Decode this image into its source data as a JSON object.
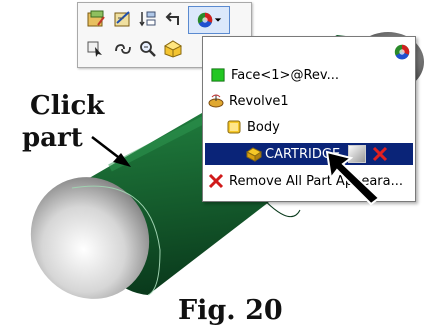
{
  "figure": {
    "click_label": "Click",
    "part_label": "part",
    "caption": "Fig. 20"
  },
  "toolbar": {
    "icons": [
      "edit-feature-icon",
      "edit-sketch-icon",
      "rebuild-icon",
      "back-arrow-icon",
      "appearance-icon",
      "dropdown-arrow-icon",
      "select-other-icon",
      "link-icon",
      "zoom-icon",
      "hide-show-icon"
    ]
  },
  "popup": {
    "items": [
      {
        "label": "Face<1>@Rev...",
        "icon": "face-icon"
      },
      {
        "label": "Revolve1",
        "icon": "revolve-icon"
      },
      {
        "label": "Body",
        "icon": "body-icon"
      },
      {
        "label": "CARTRIDGE",
        "icon": "part-icon",
        "selected": true
      },
      {
        "label": "Remove All Part Appeara...",
        "icon": "remove-x-icon"
      }
    ]
  },
  "colors": {
    "part_green": "#1f6b35",
    "cap_gray": "#d9d9d9",
    "selection_blue": "#0a2478",
    "remove_red": "#d01a1a"
  }
}
